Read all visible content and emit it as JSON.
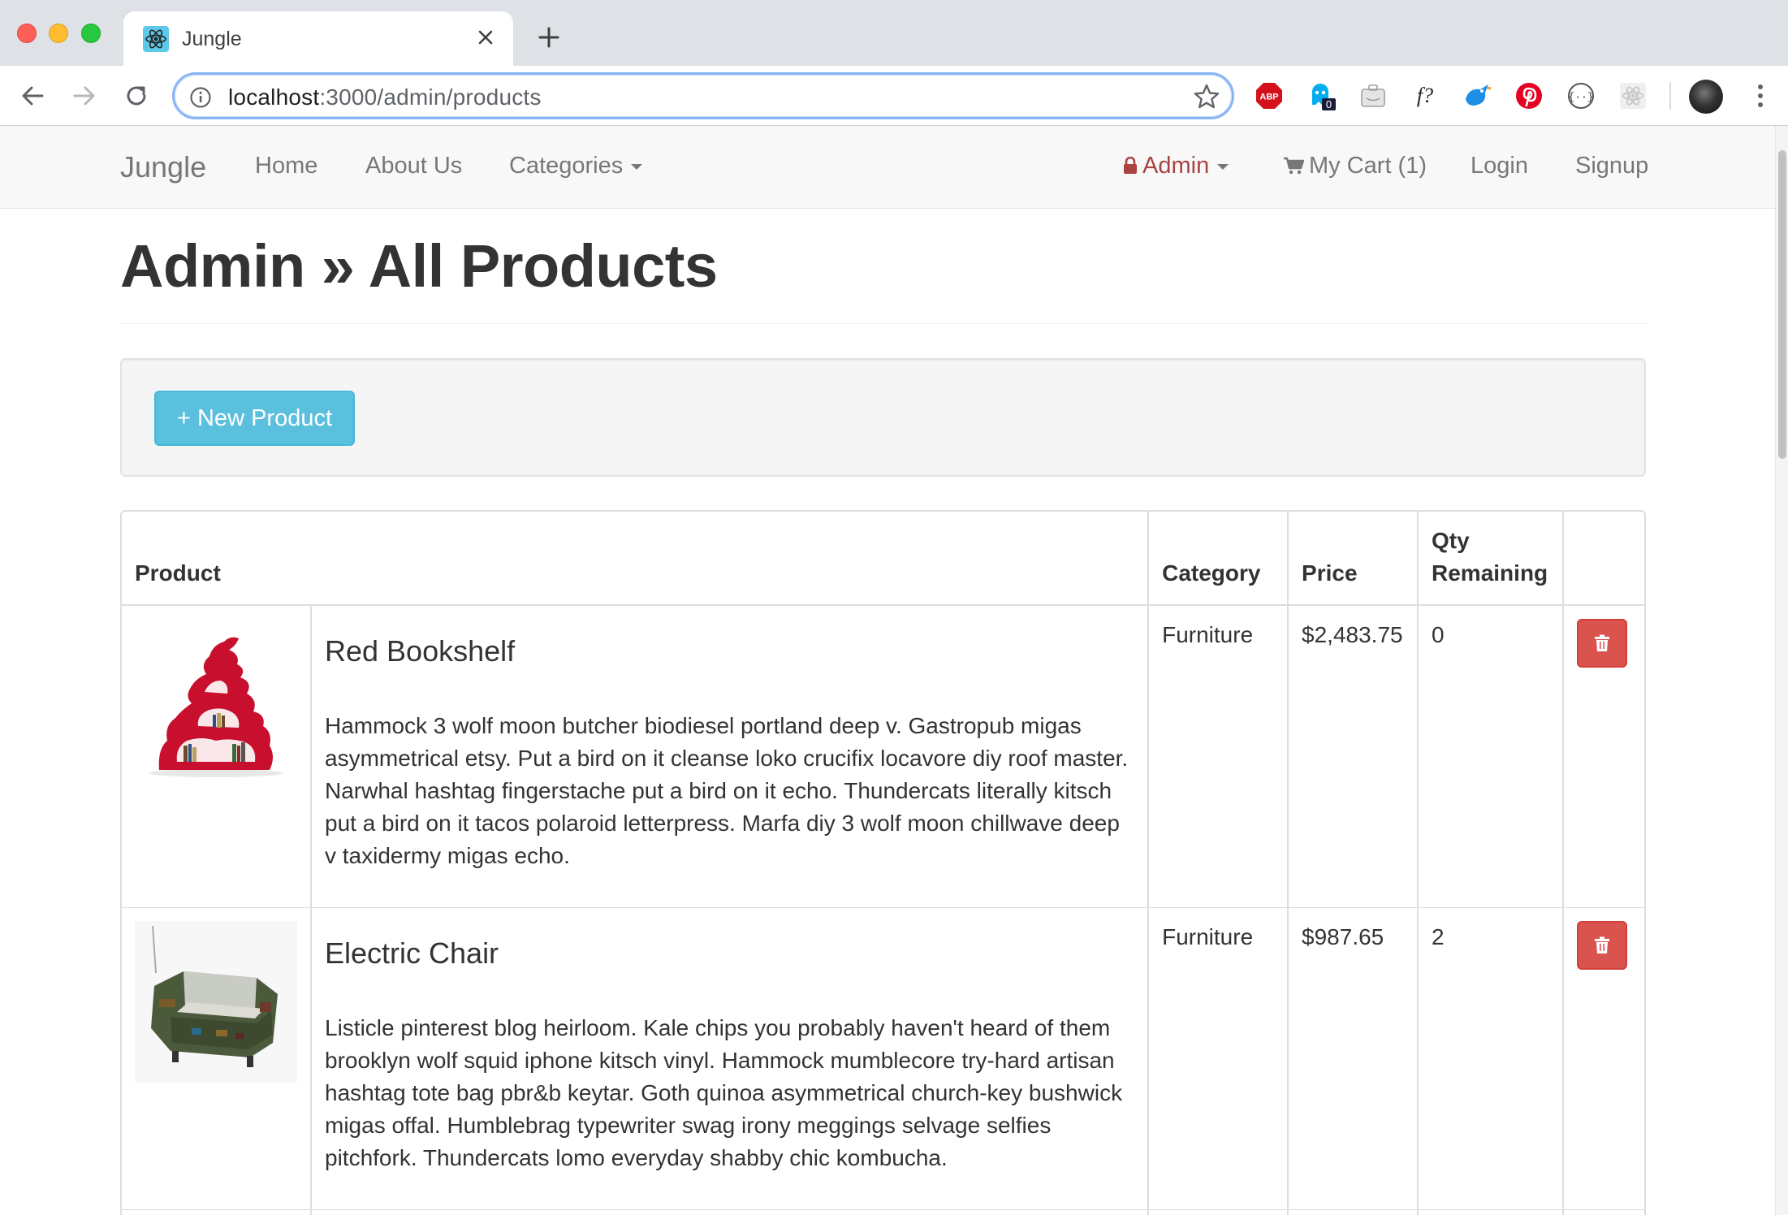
{
  "browser": {
    "tab_title": "Jungle",
    "url_host": "localhost",
    "url_path": ":3000/admin/products",
    "extensions": [
      "adblock-plus-icon",
      "ghostery-icon",
      "briefcase-icon",
      "font-finder-icon",
      "bird-icon",
      "pinterest-icon",
      "json-viewer-icon",
      "react-devtools-icon"
    ],
    "abp_label": "ABP",
    "ghostery_badge": "0",
    "font_ext_label": "f?"
  },
  "navbar": {
    "brand": "Jungle",
    "home": "Home",
    "about": "About Us",
    "categories": "Categories",
    "admin": "Admin",
    "cart": "My Cart (1)",
    "login": "Login",
    "signup": "Signup"
  },
  "page": {
    "title": "Admin » All Products",
    "new_product_button": "+ New Product"
  },
  "table": {
    "headers": {
      "product": "Product",
      "category": "Category",
      "price": "Price",
      "qty_line1": "Qty",
      "qty_line2": "Remaining"
    },
    "rows": [
      {
        "name": "Red Bookshelf",
        "description": "Hammock 3 wolf moon butcher biodiesel portland deep v. Gastropub migas asymmetrical etsy. Put a bird on it cleanse loko crucifix locavore diy roof master. Narwhal hashtag fingerstache put a bird on it echo. Thundercats literally kitsch put a bird on it tacos polaroid letterpress. Marfa diy 3 wolf moon chillwave deep v taxidermy migas echo.",
        "category": "Furniture",
        "price": "$2,483.75",
        "qty": "0"
      },
      {
        "name": "Electric Chair",
        "description": "Listicle pinterest blog heirloom. Kale chips you probably haven't heard of them brooklyn wolf squid iphone kitsch vinyl. Hammock mumblecore try-hard artisan hashtag tote bag pbr&b keytar. Goth quinoa asymmetrical church-key bushwick migas offal. Humblebrag typewriter swag irony meggings selvage selfies pitchfork. Thundercats lomo everyday shabby chic kombucha.",
        "category": "Furniture",
        "price": "$987.65",
        "qty": "2"
      }
    ]
  },
  "colors": {
    "info_button": "#5bc0de",
    "danger_button": "#d9534f",
    "admin_link": "#a94442",
    "navbar_bg": "#f8f8f8"
  }
}
